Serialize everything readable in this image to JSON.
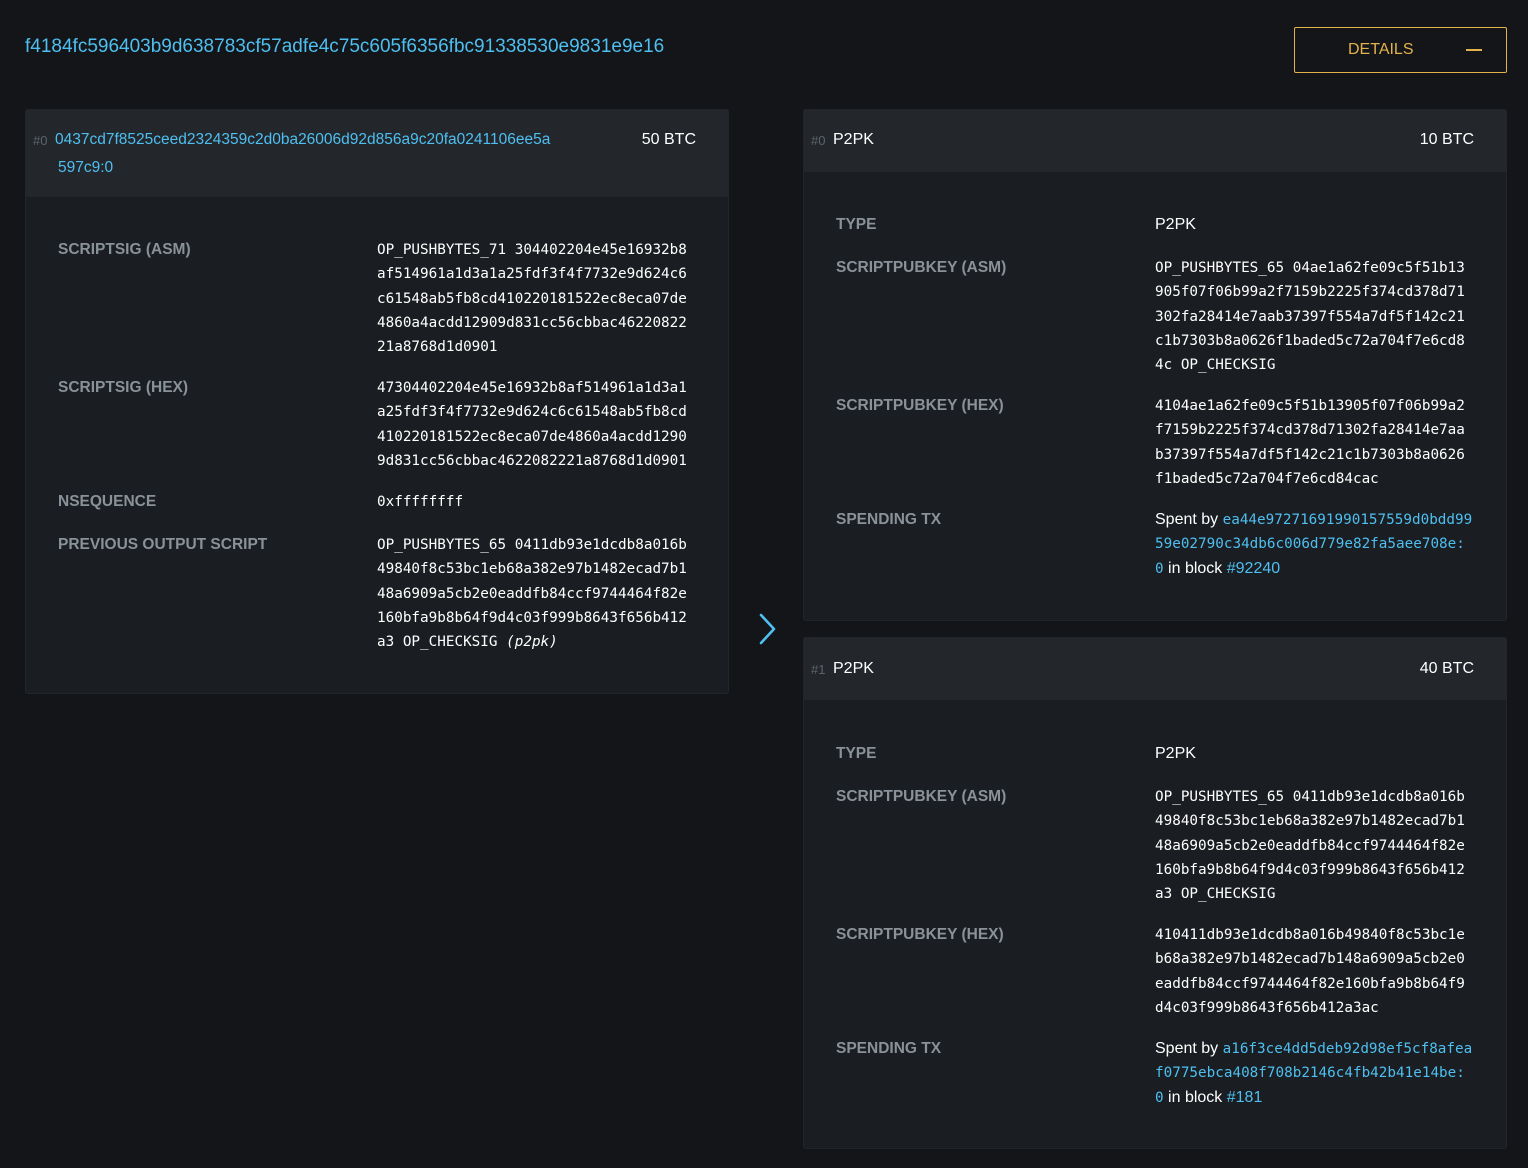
{
  "header": {
    "txid": "f4184fc596403b9d638783cf57adfe4c75c605f6356fbc91338530e9831e9e16",
    "details_label": "DETAILS",
    "details_icon": "minus-icon"
  },
  "arrow_icon": "chevron-right-icon",
  "colors": {
    "background": "#131518",
    "panel": "#1a1d21",
    "panel_header": "#23272c",
    "link": "#4ebff0",
    "accent": "#e3b34b",
    "label": "#8a9299"
  },
  "input": {
    "index": "#0",
    "prevout_line1": "0437cd7f8525ceed2324359c2d0ba26006d92d856a9c20fa0241106ee5a",
    "prevout_line2": "597c9:0",
    "amount": "50 BTC",
    "scriptsig_asm_label": "SCRIPTSIG (ASM)",
    "scriptsig_asm": "OP_PUSHBYTES_71 304402204e45e16932b8\naf514961a1d3a1a25fdf3f4f7732e9d624c6\nc61548ab5fb8cd410220181522ec8eca07de\n4860a4acdd12909d831cc56cbbac46220822\n21a8768d1d0901",
    "scriptsig_hex_label": "SCRIPTSIG (HEX)",
    "scriptsig_hex": "47304402204e45e16932b8af514961a1d3a1\na25fdf3f4f7732e9d624c6c61548ab5fb8cd\n410220181522ec8eca07de4860a4acdd1290\n9d831cc56cbbac4622082221a8768d1d0901",
    "nsequence_label": "NSEQUENCE",
    "nsequence": "0xffffffff",
    "prev_script_label": "PREVIOUS OUTPUT SCRIPT",
    "prev_script": "OP_PUSHBYTES_65 0411db93e1dcdb8a016b\n49840f8c53bc1eb68a382e97b1482ecad7b1\n48a6909a5cb2e0eaddfb84ccf9744464f82e\n160bfa9b8b64f9d4c03f999b8643f656b412\na3 OP_CHECKSIG ",
    "prev_script_type": "(p2pk)"
  },
  "outputs": [
    {
      "index": "#0",
      "type_header": "P2PK",
      "amount": "10 BTC",
      "type_label": "TYPE",
      "type": "P2PK",
      "asm_label": "SCRIPTPUBKEY (ASM)",
      "asm": "OP_PUSHBYTES_65 04ae1a62fe09c5f51b13\n905f07f06b99a2f7159b2225f374cd378d71\n302fa28414e7aab37397f554a7df5f142c21\nc1b7303b8a0626f1baded5c72a704f7e6cd8\n4c OP_CHECKSIG",
      "hex_label": "SCRIPTPUBKEY (HEX)",
      "hex": "4104ae1a62fe09c5f51b13905f07f06b99a2\nf7159b2225f374cd378d71302fa28414e7aa\nb37397f554a7df5f142c21c1b7303b8a0626\nf1baded5c72a704f7e6cd84cac",
      "spending_label": "SPENDING TX",
      "spent_by": "Spent by ",
      "spending_tx_1": "ea44e97271691990157559d0bdd99",
      "spending_tx_2": "59e02790c34db6c006d779e82fa5aee708e:",
      "spending_tx_3": "0",
      "in_block": " in block ",
      "block": "#92240"
    },
    {
      "index": "#1",
      "type_header": "P2PK",
      "amount": "40 BTC",
      "type_label": "TYPE",
      "type": "P2PK",
      "asm_label": "SCRIPTPUBKEY (ASM)",
      "asm": "OP_PUSHBYTES_65 0411db93e1dcdb8a016b\n49840f8c53bc1eb68a382e97b1482ecad7b1\n48a6909a5cb2e0eaddfb84ccf9744464f82e\n160bfa9b8b64f9d4c03f999b8643f656b412\na3 OP_CHECKSIG",
      "hex_label": "SCRIPTPUBKEY (HEX)",
      "hex": "410411db93e1dcdb8a016b49840f8c53bc1e\nb68a382e97b1482ecad7b148a6909a5cb2e0\neaddfb84ccf9744464f82e160bfa9b8b64f9\nd4c03f999b8643f656b412a3ac",
      "spending_label": "SPENDING TX",
      "spent_by": "Spent by ",
      "spending_tx_1": "a16f3ce4dd5deb92d98ef5cf8afea",
      "spending_tx_2": "f0775ebca408f708b2146c4fb42b41e14be:",
      "spending_tx_3": "0",
      "in_block": " in block ",
      "block": "#181"
    }
  ]
}
